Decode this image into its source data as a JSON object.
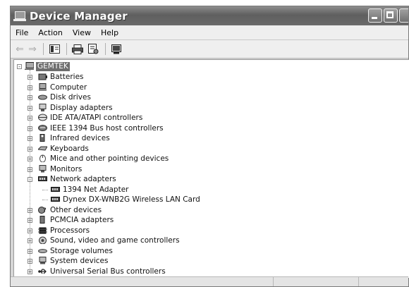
{
  "window": {
    "title": "Device Manager"
  },
  "menu": [
    "File",
    "Action",
    "View",
    "Help"
  ],
  "toolbar": {
    "buttons": [
      {
        "name": "back-button",
        "icon": "back-arrow-icon"
      },
      {
        "name": "forward-button",
        "icon": "forward-arrow-icon"
      },
      {
        "name": "show-hide-console-tree-button",
        "icon": "console-tree-icon"
      },
      {
        "name": "print-button",
        "icon": "printer-icon"
      },
      {
        "name": "properties-button",
        "icon": "properties-icon"
      },
      {
        "name": "scan-hardware-button",
        "icon": "scan-icon"
      }
    ]
  },
  "tree": {
    "root": {
      "label": "GEMTEK",
      "icon": "computer-icon",
      "expanded": true
    },
    "categories": [
      {
        "label": "Batteries",
        "icon": "battery-icon",
        "expanded": false
      },
      {
        "label": "Computer",
        "icon": "computer-icon",
        "expanded": false
      },
      {
        "label": "Disk drives",
        "icon": "disk-drive-icon",
        "expanded": false
      },
      {
        "label": "Display adapters",
        "icon": "display-adapter-icon",
        "expanded": false
      },
      {
        "label": "IDE ATA/ATAPI controllers",
        "icon": "ide-controller-icon",
        "expanded": false
      },
      {
        "label": "IEEE 1394 Bus host controllers",
        "icon": "ieee1394-icon",
        "expanded": false
      },
      {
        "label": "Infrared devices",
        "icon": "infrared-icon",
        "expanded": false
      },
      {
        "label": "Keyboards",
        "icon": "keyboard-icon",
        "expanded": false
      },
      {
        "label": "Mice and other pointing devices",
        "icon": "mouse-icon",
        "expanded": false
      },
      {
        "label": "Monitors",
        "icon": "monitor-icon",
        "expanded": false
      },
      {
        "label": "Network adapters",
        "icon": "network-adapter-icon",
        "expanded": true,
        "children": [
          {
            "label": "1394 Net Adapter",
            "icon": "network-adapter-icon"
          },
          {
            "label": "Dynex DX-WNB2G Wireless LAN Card",
            "icon": "network-adapter-icon"
          }
        ]
      },
      {
        "label": "Other devices",
        "icon": "unknown-device-icon",
        "expanded": false
      },
      {
        "label": "PCMCIA adapters",
        "icon": "pcmcia-icon",
        "expanded": false
      },
      {
        "label": "Processors",
        "icon": "processor-icon",
        "expanded": false
      },
      {
        "label": "Sound, video and game controllers",
        "icon": "sound-icon",
        "expanded": false
      },
      {
        "label": "Storage volumes",
        "icon": "storage-volume-icon",
        "expanded": false
      },
      {
        "label": "System devices",
        "icon": "system-device-icon",
        "expanded": false
      },
      {
        "label": "Universal Serial Bus controllers",
        "icon": "usb-icon",
        "expanded": false
      }
    ]
  },
  "colors": {
    "titlebar": "#6a6a6a",
    "selection": "#6e6e6e",
    "window_bg": "#efefef"
  }
}
